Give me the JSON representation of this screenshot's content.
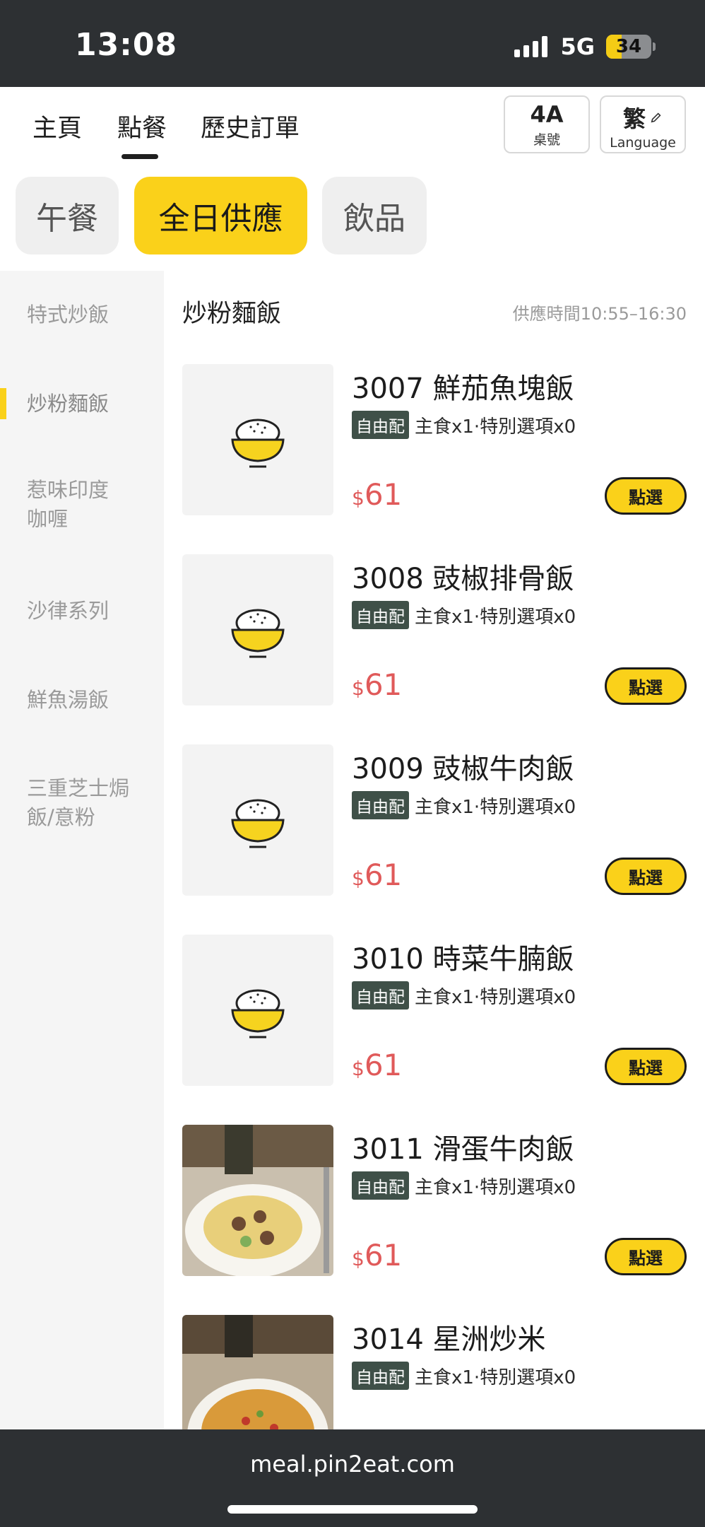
{
  "status_bar": {
    "time": "13:08",
    "network": "5G",
    "battery": "34"
  },
  "nav": {
    "tabs": [
      "主頁",
      "點餐",
      "歷史訂單"
    ],
    "active_tab": "點餐",
    "table": {
      "number": "4A",
      "label": "桌號"
    },
    "language": {
      "label": "繁",
      "sub": "Language"
    }
  },
  "meal_types": [
    "午餐",
    "全日供應",
    "飲品"
  ],
  "active_meal_type": "全日供應",
  "sidebar": {
    "items": [
      "特式炒飯",
      "炒粉麵飯",
      "惹味印度咖喱",
      "沙律系列",
      "鮮魚湯飯",
      "三重芝士焗飯/意粉"
    ],
    "active": "炒粉麵飯"
  },
  "section": {
    "title": "炒粉麵飯",
    "hours": "供應時間10:55–16:30"
  },
  "items": [
    {
      "name": "3007 鮮茄魚塊飯",
      "tag": "自由配",
      "meta": "主食x1·特別選項x0",
      "currency": "$",
      "price": "61",
      "button": "點選",
      "image": "rice-bowl-icon"
    },
    {
      "name": "3008 豉椒排骨飯",
      "tag": "自由配",
      "meta": "主食x1·特別選項x0",
      "currency": "$",
      "price": "61",
      "button": "點選",
      "image": "rice-bowl-icon"
    },
    {
      "name": "3009 豉椒牛肉飯",
      "tag": "自由配",
      "meta": "主食x1·特別選項x0",
      "currency": "$",
      "price": "61",
      "button": "點選",
      "image": "rice-bowl-icon"
    },
    {
      "name": "3010 時菜牛腩飯",
      "tag": "自由配",
      "meta": "主食x1·特別選項x0",
      "currency": "$",
      "price": "61",
      "button": "點選",
      "image": "rice-bowl-icon"
    },
    {
      "name": "3011 滑蛋牛肉飯",
      "tag": "自由配",
      "meta": "主食x1·特別選項x0",
      "currency": "$",
      "price": "61",
      "button": "點選",
      "image": "food-photo"
    },
    {
      "name": "3014 星洲炒米",
      "tag": "自由配",
      "meta": "主食x1·特別選項x0",
      "image": "food-photo"
    }
  ],
  "url_bar": {
    "url": "meal.pin2eat.com"
  },
  "colors": {
    "accent": "#fad11a",
    "price": "#e05a5a",
    "tag": "#3f5048",
    "status_bar": "#2d3033"
  }
}
